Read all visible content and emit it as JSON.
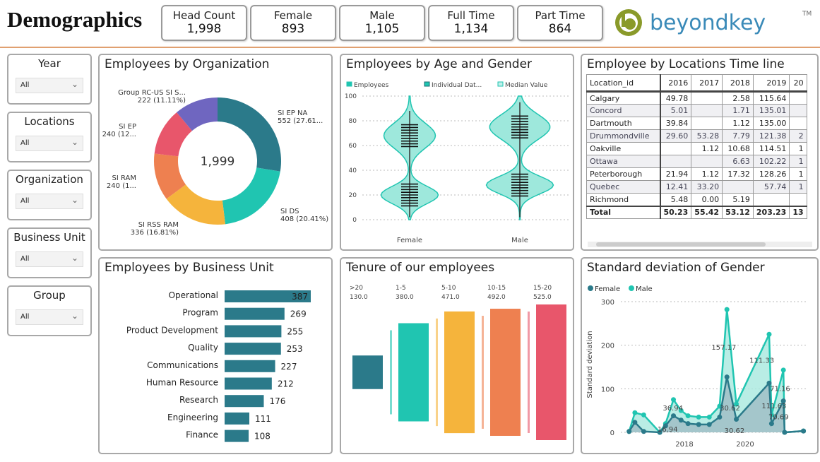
{
  "header": {
    "title": "Demographics",
    "kpis": [
      {
        "label": "Head Count",
        "value": "1,998"
      },
      {
        "label": "Female",
        "value": "893"
      },
      {
        "label": "Male",
        "value": "1,105"
      },
      {
        "label": "Full Time",
        "value": "1,134"
      },
      {
        "label": "Part Time",
        "value": "864"
      }
    ],
    "logo_text": "beyondkey",
    "logo_tm": "TM"
  },
  "filters": [
    {
      "label": "Year",
      "value": "All"
    },
    {
      "label": "Locations",
      "value": "All"
    },
    {
      "label": "Organization",
      "value": "All"
    },
    {
      "label": "Business Unit",
      "value": "All"
    },
    {
      "label": "Group",
      "value": "All"
    }
  ],
  "colors": {
    "teal_dark": "#2b7a8a",
    "teal": "#20c5b1",
    "yellow": "#f5b43c",
    "orange": "#ee8050",
    "red": "#e8566b",
    "purple": "#6f66c0",
    "accent_rule": "#e0a070"
  },
  "panels": {
    "org": "Employees by Organization",
    "age": "Employees by Age and Gender",
    "loc": "Employee by Locations Time line",
    "bu": "Employees by Business Unit",
    "tenure": "Tenure of our employees",
    "std": "Standard deviation of Gender"
  },
  "location_table": {
    "headers": [
      "Location_id",
      "2016",
      "2017",
      "2018",
      "2019",
      "20"
    ],
    "rows": [
      [
        "Calgary",
        "49.78",
        "",
        "2.58",
        "115.64",
        ""
      ],
      [
        "Concord",
        "5.01",
        "",
        "1.71",
        "135.01",
        ""
      ],
      [
        "Dartmouth",
        "39.84",
        "",
        "1.12",
        "135.00",
        ""
      ],
      [
        "Drummondville",
        "29.60",
        "53.28",
        "7.79",
        "121.38",
        "2"
      ],
      [
        "Oakville",
        "",
        "1.12",
        "10.68",
        "114.51",
        "1"
      ],
      [
        "Ottawa",
        "",
        "",
        "6.63",
        "102.22",
        "1"
      ],
      [
        "Peterborough",
        "21.94",
        "1.12",
        "17.32",
        "128.26",
        "1"
      ],
      [
        "Quebec",
        "12.41",
        "33.20",
        "",
        "57.74",
        "1"
      ],
      [
        "Richmond",
        "5.48",
        "0.00",
        "5.19",
        "",
        ""
      ]
    ],
    "total": [
      "Total",
      "50.23",
      "55.42",
      "53.12",
      "203.23",
      "13"
    ]
  },
  "chart_data": [
    {
      "type": "pie",
      "variant": "donut",
      "center_label": "1,999",
      "slices": [
        {
          "name": "SI EP NA",
          "value": 552,
          "label": "552 (27.61..."
        },
        {
          "name": "SI DS",
          "value": 408,
          "label": "408 (20.41%)"
        },
        {
          "name": "SI RSS RAM",
          "value": 336,
          "label": "336 (16.81%)"
        },
        {
          "name": "SI RAM",
          "value": 240,
          "label": "240 (1..."
        },
        {
          "name": "SI EP",
          "value": 240,
          "label": "240 (12..."
        },
        {
          "name": "Group RC-US SI S...",
          "value": 222,
          "label": "222 (11.11%)"
        }
      ]
    },
    {
      "type": "violin",
      "categories": [
        "Female",
        "Male"
      ],
      "legend": [
        "Employees",
        "Individual Dat...",
        "Median Value"
      ],
      "ylim": [
        0,
        100
      ],
      "yticks": [
        0,
        20,
        40,
        60,
        80,
        100
      ],
      "modes": {
        "Female": [
          68,
          20
        ],
        "Male": [
          75,
          28
        ]
      }
    },
    {
      "type": "bar",
      "orientation": "horizontal",
      "categories": [
        "Operational",
        "Program",
        "Product Development",
        "Quality",
        "Communications",
        "Human Resource",
        "Research",
        "Engineering",
        "Finance"
      ],
      "values": [
        387,
        269,
        255,
        253,
        227,
        212,
        176,
        111,
        108
      ]
    },
    {
      "type": "funnel",
      "categories": [
        ">20",
        "1-5",
        "5-10",
        "10-15",
        "15-20"
      ],
      "values": [
        130.0,
        380.0,
        471.0,
        492.0,
        525.0
      ],
      "labels": [
        "130.0",
        "380.0",
        "471.0",
        "492.0",
        "525.0"
      ]
    },
    {
      "type": "area",
      "ylabel": "Standard deviation",
      "ylim": [
        0,
        300
      ],
      "yticks": [
        0,
        100,
        200,
        300
      ],
      "xticks": [
        "2018",
        "2020"
      ],
      "legend_position": "top-left",
      "x": [
        2016.18,
        2016.37,
        2016.66,
        2017.19,
        2017.38,
        2017.64,
        2017.89,
        2018.12,
        2018.47,
        2018.82,
        2019.16,
        2019.4,
        2019.71,
        2020.79,
        2020.87,
        2021.26,
        2021.3,
        2021.92
      ],
      "series": [
        {
          "name": "Female",
          "values": [
            2,
            23,
            2,
            0,
            15,
            38,
            28,
            20,
            18,
            18,
            35,
            127,
            30,
            113,
            20,
            72,
            0,
            3
          ]
        },
        {
          "name": "Male",
          "values": [
            2,
            45,
            40,
            0,
            20,
            75,
            50,
            38,
            35,
            35,
            60,
            282,
            65,
            225,
            40,
            143,
            0,
            3
          ]
        }
      ],
      "data_labels": [
        {
          "x": 2017.62,
          "y": 50,
          "text": "36.94"
        },
        {
          "x": 2017.45,
          "y": 2,
          "text": "16.94"
        },
        {
          "x": 2019.3,
          "y": 190,
          "text": "157.17"
        },
        {
          "x": 2019.5,
          "y": 50,
          "text": "30.62"
        },
        {
          "x": 2019.65,
          "y": -2,
          "text": "30.62"
        },
        {
          "x": 2020.55,
          "y": 160,
          "text": "111.33"
        },
        {
          "x": 2020.95,
          "y": 55,
          "text": "111.63"
        },
        {
          "x": 2021.15,
          "y": 95,
          "text": "71.16"
        },
        {
          "x": 2021.1,
          "y": 30,
          "text": "70.69"
        }
      ]
    }
  ]
}
